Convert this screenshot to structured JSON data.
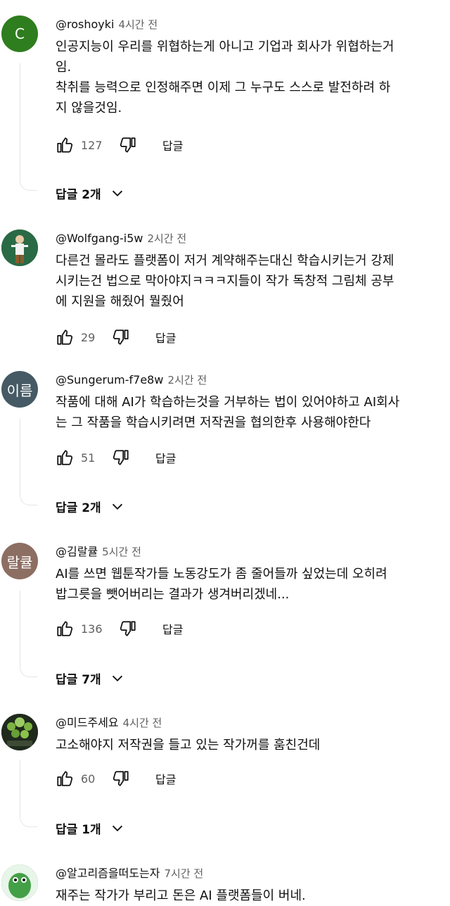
{
  "comments": [
    {
      "avatar_letter": "C",
      "avatar_color": "#2e7d1e",
      "handle": "@roshoyki",
      "time": "4시간 전",
      "lines": [
        "인공지능이 우리를 위협하는게 아니고 기업과 회사가 위협하는거",
        "임.",
        "착취를 능력으로 인정해주면 이제 그 누구도 스스로 발전하려 하",
        "지 않을것임."
      ],
      "likes": "127",
      "reply_label": "답글",
      "replies_label": "답글 2개"
    },
    {
      "avatar_letter": "",
      "avatar_color": "#1d6b4a",
      "handle": "@Wolfgang-i5w",
      "time": "2시간 전",
      "lines": [
        "다른건 몰라도 플랫폼이 저거 계약해주는대신 학습시키는거 강제",
        "시키는건 법으로 막아야지ㅋㅋㅋ지들이 작가 독창적 그림체 공부",
        "에 지원을 해줬어 뭘줬어"
      ],
      "likes": "29",
      "reply_label": "답글",
      "replies_label": ""
    },
    {
      "avatar_letter": "이름",
      "avatar_color": "#455a64",
      "handle": "@Sungerum-f7e8w",
      "time": "2시간 전",
      "lines": [
        "작품에 대해 AI가 학습하는것을 거부하는 법이 있어야하고 AI회사",
        "는 그 작품을 학습시키려면 저작권을 협의한후 사용해야한다"
      ],
      "likes": "51",
      "reply_label": "답글",
      "replies_label": "답글 2개"
    },
    {
      "avatar_letter": "랄큘",
      "avatar_color": "#8d6e63",
      "handle": "@김랄큘",
      "time": "5시간 전",
      "lines": [
        "AI를 쓰면 웹툰작가들 노동강도가 좀 줄어들까 싶었는데 오히려",
        "밥그릇을 뺏어버리는 결과가 생겨버리겠네..."
      ],
      "likes": "136",
      "reply_label": "답글",
      "replies_label": "답글 7개"
    },
    {
      "avatar_letter": "",
      "avatar_color": "#2f3b2a",
      "handle": "@미드주세요",
      "time": "4시간 전",
      "lines": [
        "고소해야지 저작권을 들고 있는 작가꺼를 훔친건데"
      ],
      "likes": "60",
      "reply_label": "답글",
      "replies_label": "답글 1개"
    },
    {
      "avatar_letter": "",
      "avatar_color": "#2e7d32",
      "handle": "@알고리즘을떠도는자",
      "time": "7시간 전",
      "lines": [
        "재주는 작가가 부리고 돈은 AI 플랫폼들이 버네."
      ],
      "likes": "",
      "reply_label": "",
      "replies_label": ""
    }
  ]
}
